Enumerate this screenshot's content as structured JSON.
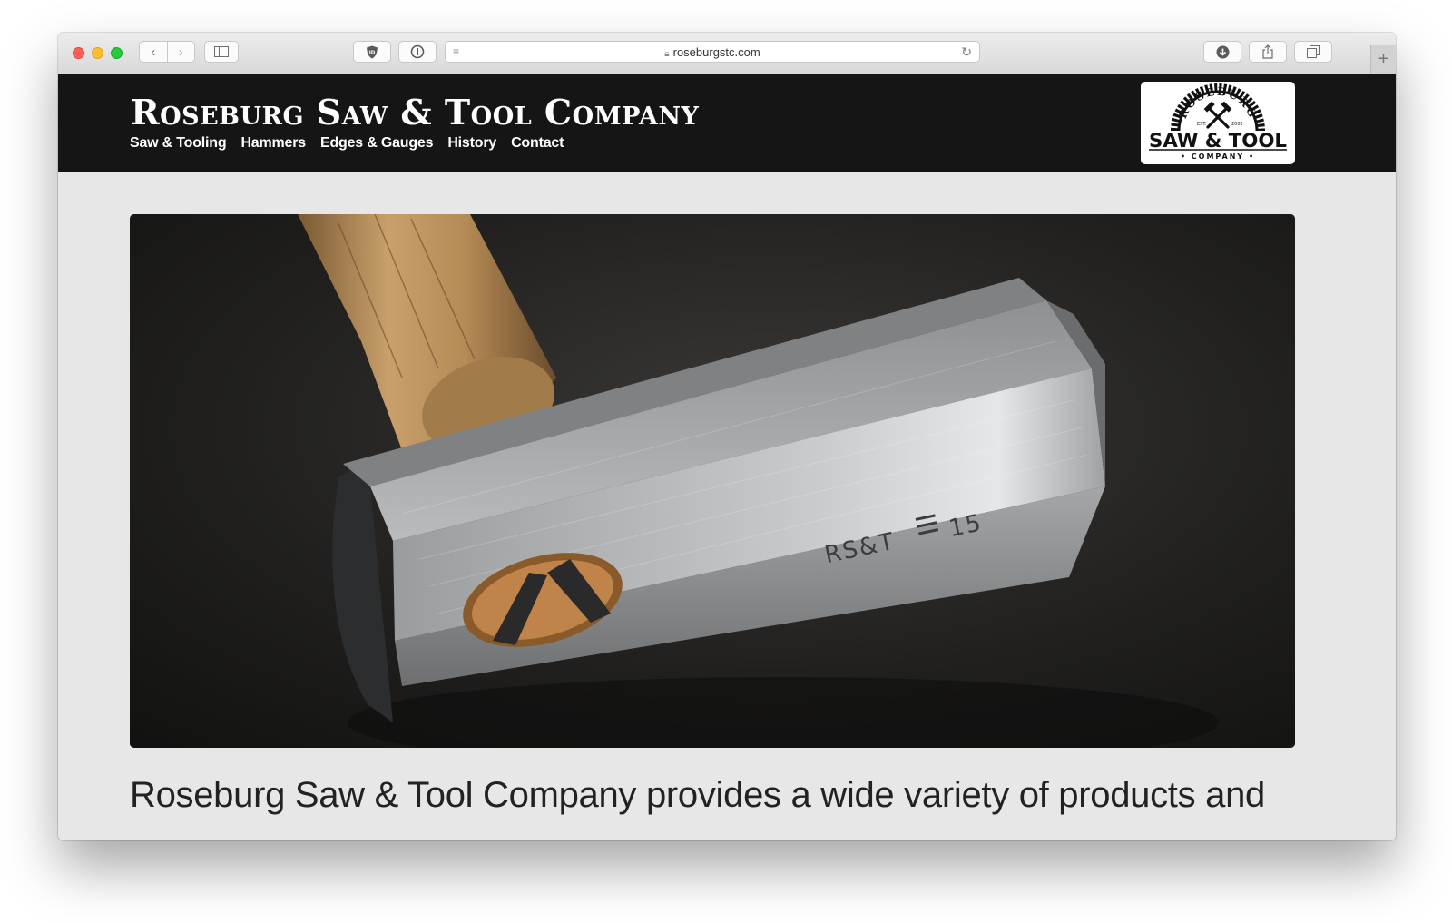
{
  "browser": {
    "url": "roseburgstc.com",
    "icons": {
      "back": "chevron-left-icon",
      "forward": "chevron-right-icon",
      "sidebar": "sidebar-icon",
      "shield": "shield-extension-icon",
      "password": "password-extension-icon",
      "reader": "reader-icon",
      "lock": "lock-icon",
      "reload": "reload-icon",
      "download": "download-icon",
      "share": "share-icon",
      "tabs": "tabs-icon",
      "new_tab": "plus-icon"
    }
  },
  "site": {
    "title": "Roseburg Saw & Tool Company",
    "nav": [
      "Saw & Tooling",
      "Hammers",
      "Edges & Gauges",
      "History",
      "Contact"
    ],
    "logo": {
      "arc_text": "ROSEBURG",
      "est": "EST.",
      "year": "2002",
      "main": "SAW & TOOL",
      "sub": "• COMPANY •"
    },
    "hero": {
      "stamp_left": "RS&T",
      "stamp_right": "15",
      "alt_subject": "hammer-head-photo"
    },
    "lead_text": "Roseburg Saw & Tool Company provides a wide variety of products and"
  },
  "colors": {
    "header_bg": "#151515",
    "page_bg": "#e7e7e7",
    "text": "#222222"
  }
}
